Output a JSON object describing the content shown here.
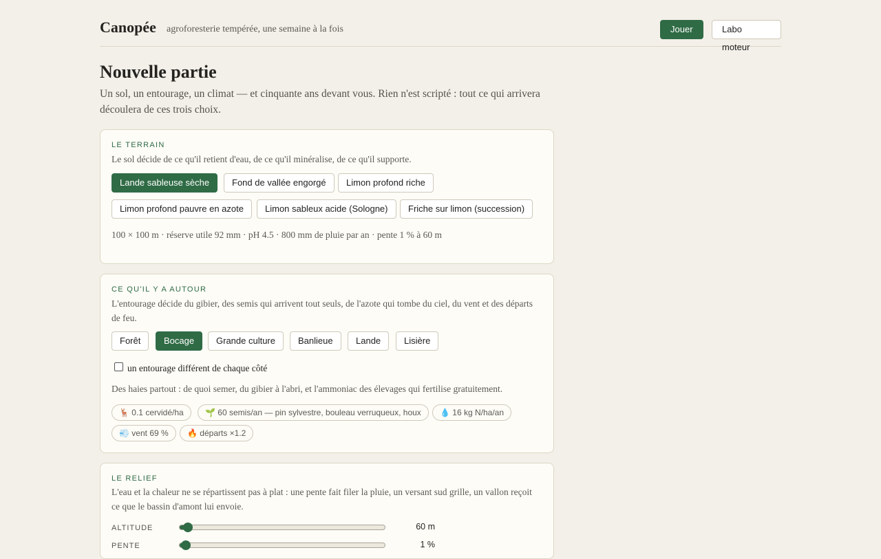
{
  "header": {
    "brand": "Canopée",
    "tagline": "agroforesterie tempérée, une semaine à la fois",
    "play_label": "Jouer",
    "lab_label": "Labo moteur"
  },
  "page": {
    "title": "Nouvelle partie",
    "intro": "Un sol, un entourage, un climat — et cinquante ans devant vous. Rien n'est scripté : tout ce qui arrivera découlera de ces trois choix."
  },
  "terrain": {
    "kicker": "LE TERRAIN",
    "description": "Le sol décide de ce qu'il retient d'eau, de ce qu'il minéralise, de ce qu'il supporte.",
    "options": [
      {
        "label": "Lande sableuse sèche",
        "selected": true
      },
      {
        "label": "Fond de vallée engorgé",
        "selected": false
      },
      {
        "label": "Limon profond riche",
        "selected": false
      },
      {
        "label": "Limon profond pauvre en azote",
        "selected": false
      },
      {
        "label": "Limon sableux acide (Sologne)",
        "selected": false
      },
      {
        "label": "Friche sur limon (succession)",
        "selected": false
      }
    ],
    "summary": "100 × 100 m · réserve utile 92 mm · pH 4.5 · 800 mm de pluie par an · pente 1 % à 60 m"
  },
  "surroundings": {
    "kicker": "CE QU'IL Y A AUTOUR",
    "description": "L'entourage décide du gibier, des semis qui arrivent tout seuls, de l'azote qui tombe du ciel, du vent et des départs de feu.",
    "options": [
      {
        "label": "Forêt",
        "selected": false
      },
      {
        "label": "Bocage",
        "selected": true
      },
      {
        "label": "Grande culture",
        "selected": false
      },
      {
        "label": "Banlieue",
        "selected": false
      },
      {
        "label": "Lande",
        "selected": false
      },
      {
        "label": "Lisière",
        "selected": false
      }
    ],
    "checkbox_label": "un entourage différent de chaque côté",
    "checkbox_checked": false,
    "note": "Des haies partout : de quoi semer, du gibier à l'abri, et l'ammoniac des élevages qui fertilise gratuitement.",
    "stats": [
      {
        "icon": "deer-icon",
        "glyph": "🦌",
        "text": "0.1 cervidé/ha"
      },
      {
        "icon": "seedling-icon",
        "glyph": "🌱",
        "text": "60 semis/an — pin sylvestre, bouleau verruqueux, houx"
      },
      {
        "icon": "droplet-icon",
        "glyph": "💧",
        "text": "16 kg N/ha/an"
      },
      {
        "icon": "wind-icon",
        "glyph": "💨",
        "text": "vent 69 %"
      },
      {
        "icon": "fire-icon",
        "glyph": "🔥",
        "text": "départs ×1.2"
      }
    ]
  },
  "relief": {
    "kicker": "LE RELIEF",
    "description": "L'eau et la chaleur ne se répartissent pas à plat : une pente fait filer la pluie, un versant sud grille, un vallon reçoit ce que le bassin d'amont lui envoie.",
    "sliders": [
      {
        "label": "ALTITUDE",
        "value": "60 m",
        "fraction": 0.04
      },
      {
        "label": "PENTE",
        "value": "1 %",
        "fraction": 0.03
      }
    ]
  },
  "colors": {
    "accent": "#2f6b45",
    "background": "#f3f0e9",
    "card": "#fdfcf7"
  }
}
